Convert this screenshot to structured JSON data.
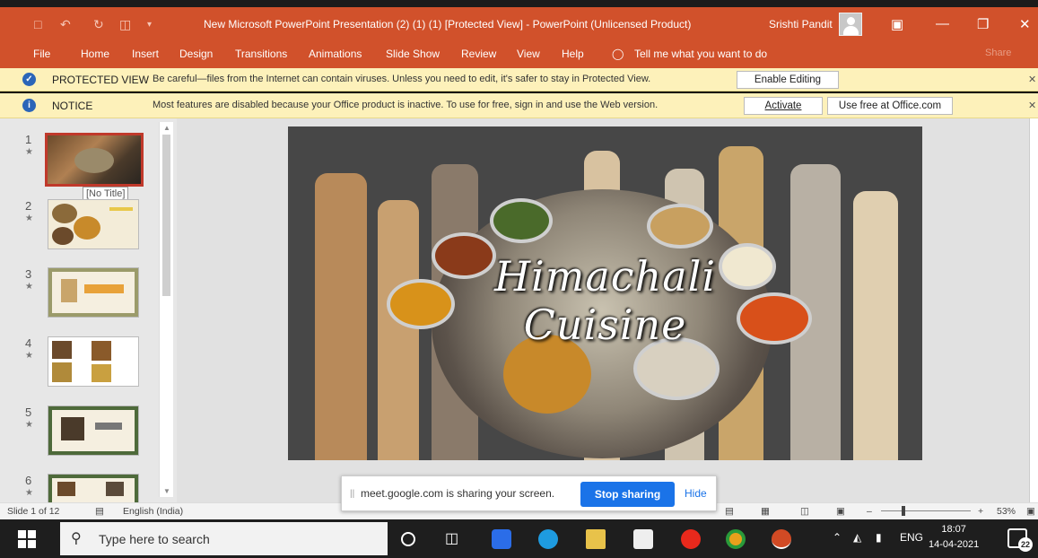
{
  "titlebar": {
    "title": "New Microsoft PowerPoint Presentation (2) (1) (1) [Protected View]  -  PowerPoint (Unlicensed Product)",
    "user": "Srishti Pandit"
  },
  "ribbon": {
    "tabs": [
      "File",
      "Home",
      "Insert",
      "Design",
      "Transitions",
      "Animations",
      "Slide Show",
      "Review",
      "View",
      "Help"
    ],
    "tell_me": "Tell me what you want to do",
    "share": "Share"
  },
  "protected_bar": {
    "label": "PROTECTED VIEW",
    "message": "Be careful—files from the Internet can contain viruses. Unless you need to edit, it's safer to stay in Protected View.",
    "button": "Enable Editing"
  },
  "notice_bar": {
    "label": "NOTICE",
    "message": "Most features are disabled because your Office product is inactive. To use for free, sign in and use the Web version.",
    "activate": "Activate",
    "use_free": "Use free at Office.com"
  },
  "thumbnails": {
    "items": [
      {
        "num": "1",
        "tooltip": "[No Title]"
      },
      {
        "num": "2"
      },
      {
        "num": "3"
      },
      {
        "num": "4"
      },
      {
        "num": "5"
      },
      {
        "num": "6"
      }
    ]
  },
  "slide": {
    "title_line1": "Himachali",
    "title_line2": "Cuisine"
  },
  "statusbar": {
    "slide_info": "Slide 1 of 12",
    "language": "English (India)",
    "zoom": "53%",
    "zoom_minus": "–",
    "zoom_plus": "+"
  },
  "share_popup": {
    "message": "meet.google.com is sharing your screen.",
    "stop": "Stop sharing",
    "hide": "Hide"
  },
  "taskbar": {
    "search_placeholder": "Type here to search",
    "lang": "ENG",
    "time": "18:07",
    "date": "14-04-2021",
    "notifications": "22"
  }
}
